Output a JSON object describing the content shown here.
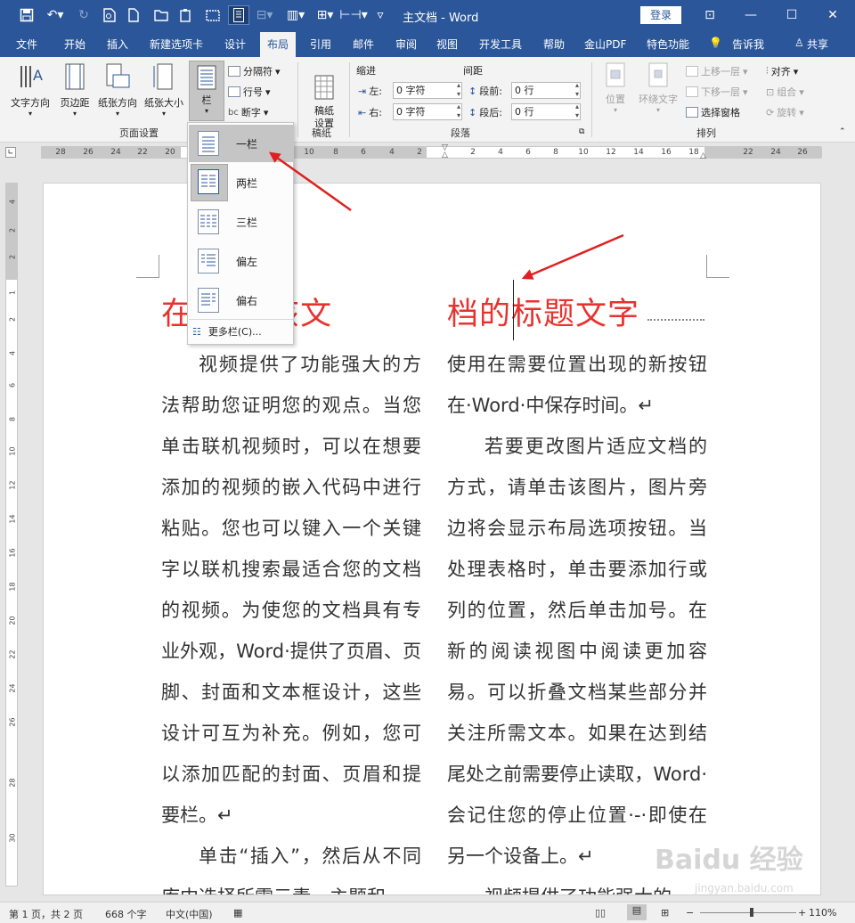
{
  "titlebar": {
    "doc_title": "主文档 - Word",
    "login_label": "登录"
  },
  "tabs": [
    "文件",
    "开始",
    "插入",
    "新建选项卡",
    "设计",
    "布局",
    "引用",
    "邮件",
    "审阅",
    "视图",
    "开发工具",
    "帮助",
    "金山PDF",
    "特色功能",
    "告诉我",
    "共享"
  ],
  "ribbon": {
    "page_setup": {
      "buttons": [
        "文字方向",
        "页边距",
        "纸张方向",
        "纸张大小",
        "栏"
      ],
      "small": [
        "分隔符",
        "行号",
        "断字"
      ],
      "group_label": "页面设置"
    },
    "manuscript": {
      "button": "稿纸\n设置",
      "group_label": "稿纸"
    },
    "paragraph": {
      "indent_label": "缩进",
      "spacing_label": "间距",
      "left_label": "左:",
      "right_label": "右:",
      "before_label": "段前:",
      "after_label": "段后:",
      "left_value": "0 字符",
      "right_value": "0 字符",
      "before_value": "0 行",
      "after_value": "0 行",
      "group_label": "段落"
    },
    "arrange": {
      "position_label": "位置",
      "wrap_label": "环绕文字",
      "bring_forward": "上移一层",
      "send_backward": "下移一层",
      "selection_pane": "选择窗格",
      "align": "对齐",
      "group": "组合",
      "rotate": "旋转",
      "group_label": "排列"
    }
  },
  "ruler": {
    "h_ticks": [
      "28",
      "26",
      "24",
      "22",
      "20",
      "10",
      "8",
      "6",
      "4",
      "2",
      "2",
      "4",
      "6",
      "8",
      "10",
      "12",
      "14",
      "16",
      "18",
      "22",
      "24",
      "26"
    ],
    "v_ticks": [
      "4",
      "2",
      "2",
      "1",
      "2",
      "4",
      "6",
      "8",
      "10",
      "12",
      "14",
      "16",
      "18",
      "20",
      "22",
      "24",
      "26",
      "28",
      "30"
    ]
  },
  "columns_menu": {
    "items": [
      "一栏",
      "两栏",
      "三栏",
      "偏左",
      "偏右"
    ],
    "more": "更多栏(C)..."
  },
  "document": {
    "heading_left": "在 输入该文",
    "heading_right": "档的标题文字",
    "col_left": [
      "视频提供了功能强大的方法帮助您证明您的观点。当您单击联机视频时，可以在想要添加的视频的嵌入代码中进行粘贴。您也可以键入一个关键字以联机搜索最适合您的文档的视频。为使您的文档具有专业外观，Word·提供了页眉、页脚、封面和文本框设计，这些设计可互为补充。例如，您可以添加匹配的封面、页眉和提要栏。↵",
      "单击“插入”，然后从不同库中选择所需元素。主题和"
    ],
    "col_right": [
      "使用在需要位置出现的新按钮在·Word·中保存时间。↵",
      "若要更改图片适应文档的方式，请单击该图片，图片旁边将会显示布局选项按钮。当处理表格时，单击要添加行或列的位置，然后单击加号。在新的阅读视图中阅读更加容易。可以折叠文档某些部分并关注所需文本。如果在达到结尾处之前需要停止读取，Word·会记住您的停止位置·-·即使在另一个设备上。↵",
      "视频提供了功能强大的"
    ]
  },
  "statusbar": {
    "page": "第 1 页，共 2 页",
    "words": "668 个字",
    "language": "中文(中国)",
    "zoom": "110%"
  },
  "watermark": {
    "text": "Baidu 经验",
    "sub": "jingyan.baidu.com"
  }
}
